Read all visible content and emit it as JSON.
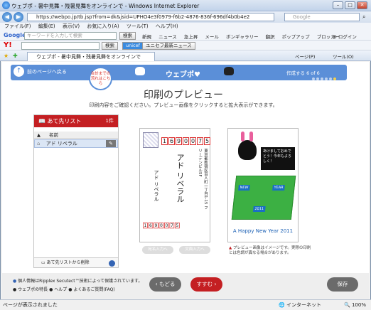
{
  "window": {
    "title": "ウェブポ - 暑中見舞・残暑見舞をオンラインで - Windows Internet Explorer"
  },
  "address": {
    "url": "https://webpo.jp/tb.jsp?from=dk&jsid=UPHO4e3f0979-f6b2-4876-836f-696df4b0b4e2",
    "search_placeholder": "Google"
  },
  "menu": [
    "ファイル(F)",
    "編集(E)",
    "表示(V)",
    "お気に入り(A)",
    "ツール(T)",
    "ヘルプ(H)"
  ],
  "google": {
    "brand": "Google",
    "placeholder": "キーワードを入力して検索",
    "search": "検索",
    "items": [
      "新規",
      "ニュース",
      "急上昇",
      "メール",
      "ボンギャラリー",
      "翻訳",
      "ポップアップ ブロッカー"
    ],
    "login": "ログイン"
  },
  "yahoo": {
    "brand": "Y!",
    "search": "検索",
    "unicef": "unicef",
    "news": "ユニセフ最新ニュース"
  },
  "tabs": {
    "active": "ウェブポ - 暑中見舞・残暑見舞をオンラインで",
    "page": "ページ(P)",
    "tools": "ツール(O)"
  },
  "header": {
    "back": "前のページへ戻る",
    "logo": "ウェブポ♥",
    "step": "作成する 6 of 6",
    "bubble": "合計までの流れはこちら"
  },
  "page": {
    "title": "印刷のプレビュー",
    "subtitle": "印刷内容をご確認ください。プレビュー画像をクリックすると拡大表示ができます。"
  },
  "panel": {
    "title": "あて先リスト",
    "count": "1件",
    "col": "名前",
    "row": "アド リベラル",
    "footer": "あて先リストから削除"
  },
  "card1": {
    "zip": [
      "1",
      "6",
      "9",
      "0",
      "0",
      "7",
      "5"
    ],
    "name": "アド リベラル",
    "addr": "東京都新宿区百人町一丁目1-15 フリーデンビル5F",
    "sender": "アド リベラル",
    "btn1": "宛名入力へ",
    "btn2": "文面入力へ"
  },
  "card2": {
    "speech": "あけましておめでとう！今年もよろしく！",
    "greeting": "A Happy New Year 2011",
    "new": "NEW",
    "year": "YEAR",
    "yr": "2011"
  },
  "note": "プレビュー画像はイメージです。実際の印刷とは色調が異なる場合があります。",
  "footer": {
    "privacy": "個人情報はRipplex Secutect™技術によって保護されています。",
    "links": [
      "ウェブポの特長",
      "ヘルプ",
      "よくあるご質問(FAQ)"
    ],
    "back": "もどる",
    "next": "すすむ",
    "save": "保存"
  },
  "status": {
    "text": "ページが表示されました",
    "zone": "インターネット",
    "zoom": "100%"
  },
  "colors": {
    "accent": "#5b8fd8",
    "red": "#c41f22",
    "grass": "#3cb043"
  }
}
